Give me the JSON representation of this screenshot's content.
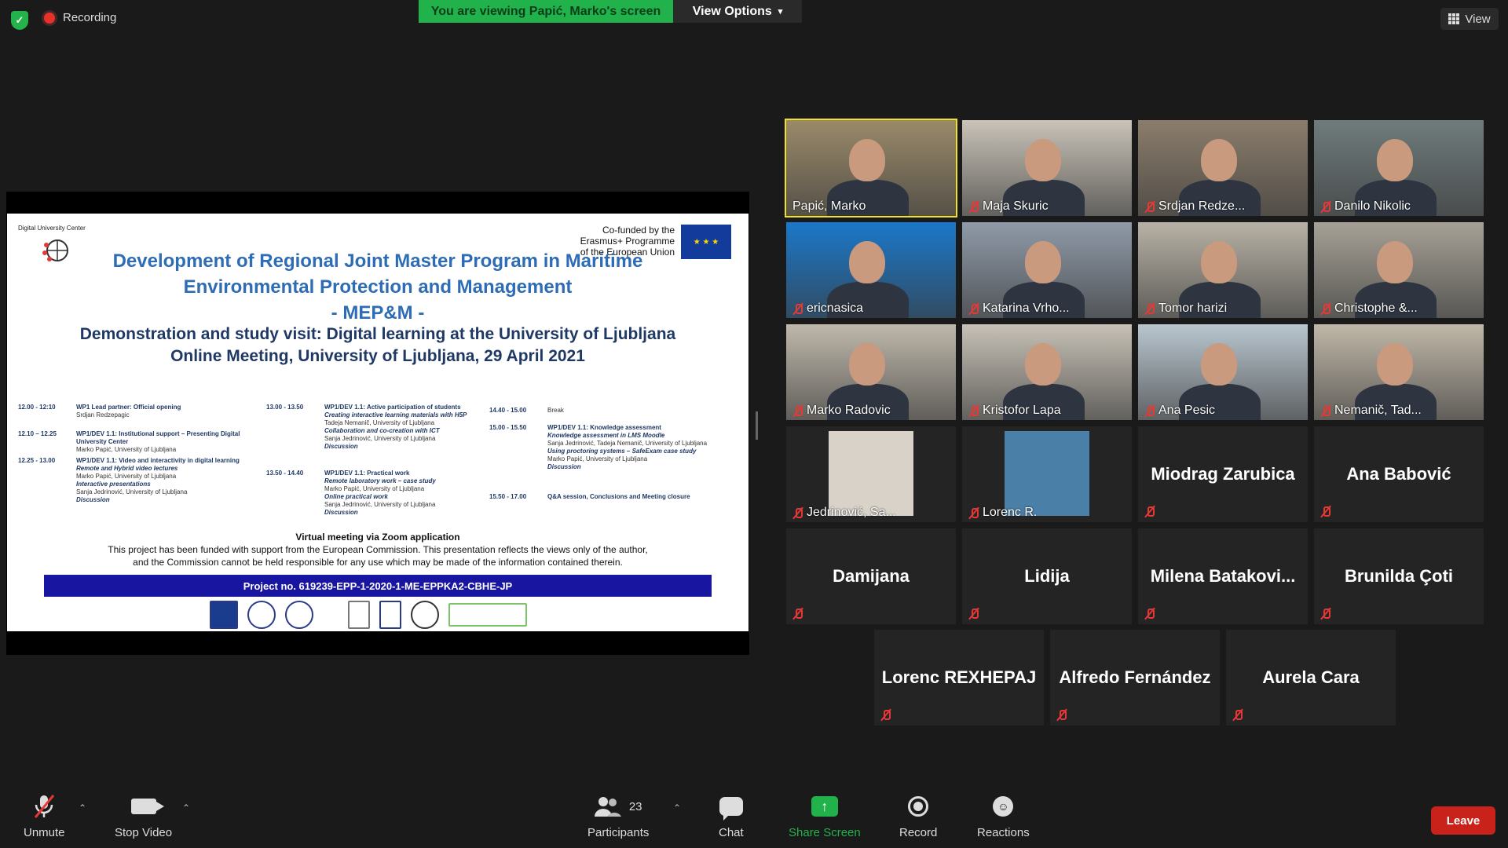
{
  "top": {
    "recording_label": "Recording",
    "viewing_banner": "You are viewing Papić, Marko's screen",
    "view_options": "View Options",
    "view_button": "View"
  },
  "slide": {
    "center_label": "Digital University Center",
    "cofund": [
      "Co-funded by the",
      "Erasmus+ Programme",
      "of the European Union"
    ],
    "title_line1": "Development of Regional Joint Master Program in Maritime",
    "title_line2": "Environmental Protection and Management",
    "title_line3": "- MEP&M -",
    "subtitle_line1": "Demonstration and study visit: Digital learning at the University of Ljubljana",
    "subtitle_line2": "Online Meeting, University of Ljubljana, 29 April 2021",
    "schedule_col1": [
      {
        "time": "12.00 - 12:10",
        "lines": [
          "WP1 Lead partner: Official opening",
          "Srdjan Redzepagic"
        ]
      },
      {
        "time": "12.10 – 12.25",
        "lines": [
          "WP1/DEV 1.1: Institutional support – Presenting Digital University Center",
          "Marko Papić, University of Ljubljana"
        ]
      },
      {
        "time": "12.25 - 13.00",
        "lines": [
          "WP1/DEV 1.1: Video and interactivity in digital learning",
          "Remote and Hybrid video lectures",
          "Marko Papić, University of Ljubljana",
          "Interactive presentations",
          "Sanja Jedrinović, University of Ljubljana",
          "Discussion"
        ]
      }
    ],
    "schedule_col2": [
      {
        "time": "13.00 - 13.50",
        "lines": [
          "WP1/DEV 1.1: Active participation of students",
          "Creating interactive learning materials with H5P",
          "Tadeja Nemanič, University of Ljubljana",
          "Collaboration and co-creation with ICT",
          "Sanja Jedrinović, University of Ljubljana",
          "Discussion"
        ]
      },
      {
        "time": "13.50 - 14.40",
        "lines": [
          "WP1/DEV 1.1: Practical work",
          "Remote laboratory work – case study",
          "Marko Papić, University of Ljubljana",
          "Online practical work",
          "Sanja Jedrinović, University of Ljubljana",
          "Discussion"
        ]
      }
    ],
    "schedule_col3": [
      {
        "time": "14.40 - 15.00",
        "lines": [
          "Break"
        ]
      },
      {
        "time": "15.00 - 15.50",
        "lines": [
          "WP1/DEV 1.1: Knowledge assessment",
          "Knowledge assessment in LMS Moodle",
          "Sanja Jedrinović, Tadeja Nemanič, University of Ljubljana",
          "Using proctoring systems – SafeExam case study",
          "Marko Papić, University of Ljubljana",
          "Discussion"
        ]
      },
      {
        "time": "15.50 - 17.00",
        "lines": [
          "Q&A session, Conclusions and Meeting closure"
        ]
      }
    ],
    "virtual": "Virtual meeting via Zoom application",
    "disclaimer1": "This project has been funded with support from the European Commission. This presentation reflects the views only of the author,",
    "disclaimer2": "and the Commission cannot be held responsible for any use which may be made of the information contained therein.",
    "project_no": "Project no. 619239-EPP-1-2020-1-ME-EPPKA2-CBHE-JP"
  },
  "participants": [
    {
      "name": "Papić, Marko",
      "type": "video",
      "muted": false,
      "active": true,
      "bg": "#9a8a6a"
    },
    {
      "name": "Maja Skuric",
      "type": "video",
      "muted": true,
      "bg": "#c9c3b8"
    },
    {
      "name": "Srdjan Redze...",
      "type": "video",
      "muted": true,
      "bg": "#8b7d6b"
    },
    {
      "name": "Danilo Nikolic",
      "type": "video",
      "muted": true,
      "bg": "#6f7b7c"
    },
    {
      "name": "ericnasica",
      "type": "video",
      "muted": true,
      "bg": "#1a78c9"
    },
    {
      "name": "Katarina Vrho...",
      "type": "video",
      "muted": true,
      "bg": "#8f9aa8"
    },
    {
      "name": "Tomor harizi",
      "type": "video",
      "muted": true,
      "bg": "#b8b2a6"
    },
    {
      "name": "Christophe &...",
      "type": "video",
      "muted": true,
      "bg": "#a6a196"
    },
    {
      "name": "Marko Radovic",
      "type": "video",
      "muted": true,
      "bg": "#bfb8ab"
    },
    {
      "name": "Kristofor Lapa",
      "type": "video",
      "muted": true,
      "bg": "#c7c1b6"
    },
    {
      "name": "Ana Pesic",
      "type": "video",
      "muted": true,
      "bg": "#b9c6cf"
    },
    {
      "name": "Nemanič, Tad...",
      "type": "video",
      "muted": true,
      "bg": "#c0b7a8"
    },
    {
      "name": "Jedrinović, Sa...",
      "type": "photo",
      "muted": true,
      "bg": "#d9d2c9"
    },
    {
      "name": "Lorenc R.",
      "type": "photo",
      "muted": true,
      "bg": "#4a7fa8"
    },
    {
      "name": "Miodrag Zarubica",
      "type": "name",
      "muted": true
    },
    {
      "name": "Ana Babović",
      "type": "name",
      "muted": true
    },
    {
      "name": "Damijana",
      "type": "name",
      "muted": true
    },
    {
      "name": "Lidija",
      "type": "name",
      "muted": true
    },
    {
      "name": "Milena Batakovi...",
      "type": "name",
      "muted": true
    },
    {
      "name": "Brunilda Çoti",
      "type": "name",
      "muted": true
    },
    {
      "name": "Lorenc REXHEPAJ",
      "type": "name",
      "muted": true
    },
    {
      "name": "Alfredo Fernández",
      "type": "name",
      "muted": true
    },
    {
      "name": "Aurela Cara",
      "type": "name",
      "muted": true
    }
  ],
  "toolbar": {
    "unmute": "Unmute",
    "stop_video": "Stop Video",
    "participants": "Participants",
    "participants_count": "23",
    "chat": "Chat",
    "share_screen": "Share Screen",
    "record": "Record",
    "reactions": "Reactions",
    "leave": "Leave"
  },
  "colors": {
    "share_green": "#22b24c",
    "leave_red": "#c9221b",
    "active_speaker": "#f0e22a",
    "muted_red": "#e53935"
  }
}
